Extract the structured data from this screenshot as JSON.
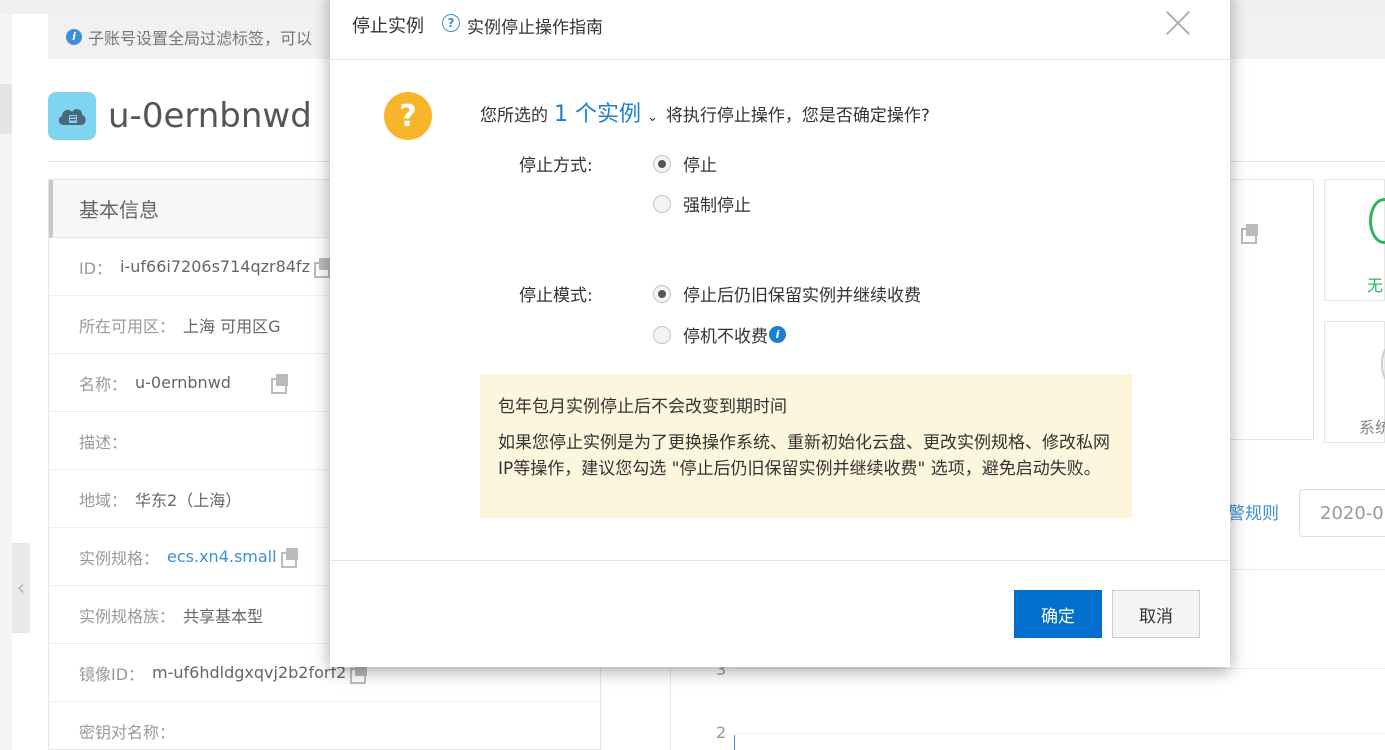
{
  "background": {
    "notice_text": "子账号设置全局过滤标签，可以",
    "instance_name": "u-0ernbnwd",
    "panel_title": "基本信息",
    "info_rows": [
      {
        "label": "ID：",
        "value": "i-uf66i7206s714qzr84fz"
      },
      {
        "label": "所在可用区：",
        "value": "上海 可用区G"
      },
      {
        "label": "名称：",
        "value": "u-0ernbnwd"
      },
      {
        "label": "描述：",
        "value": ""
      },
      {
        "label": "地域：",
        "value": "华东2（上海）"
      },
      {
        "label": "实例规格：",
        "value": "ecs.xn4.small"
      },
      {
        "label": "实例规格族：",
        "value": "共享基本型"
      },
      {
        "label": "镜像ID：",
        "value": "m-uf6hdldgxqvj2b2forf2"
      },
      {
        "label": "密钥对名称：",
        "value": ""
      }
    ],
    "status_text_green": "无",
    "status_text_gray": "系统",
    "alarm_link": "警规则",
    "date_value": "2020-0",
    "y_ticks": [
      "3",
      "2"
    ]
  },
  "dialog": {
    "title": "停止实例",
    "help_link": "实例停止操作指南",
    "prompt_before": "您所选的",
    "prompt_count": "1 个实例",
    "prompt_after": "将执行停止操作，您是否确定操作?",
    "stop_method_label": "停止方式:",
    "stop_method_options": [
      {
        "label": "停止",
        "selected": true
      },
      {
        "label": "强制停止",
        "selected": false
      }
    ],
    "stop_mode_label": "停止模式:",
    "stop_mode_options": [
      {
        "label": "停止后仍旧保留实例并继续收费",
        "selected": true
      },
      {
        "label": "停机不收费",
        "selected": false
      }
    ],
    "tip_title": "包年包月实例停止后不会改变到期时间",
    "tip_body": "如果您停止实例是为了更换操作系统、重新初始化云盘、更改实例规格、修改私网IP等操作，建议您勾选 \"停止后仍旧保留实例并继续收费\" 选项，避免启动失败。",
    "confirm_label": "确定",
    "cancel_label": "取消"
  }
}
